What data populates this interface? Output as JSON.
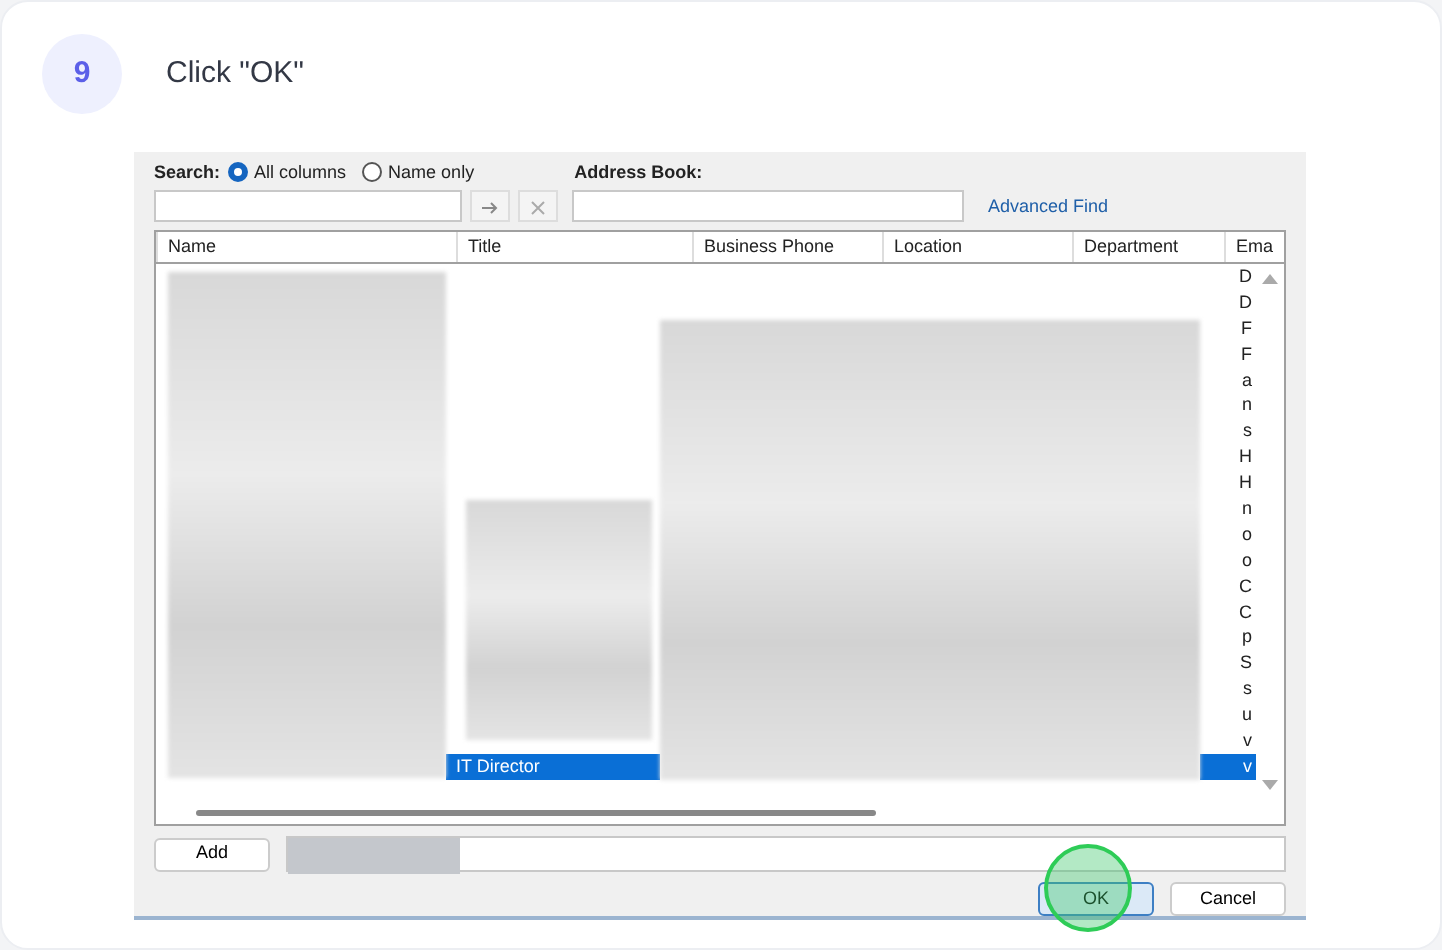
{
  "step": {
    "number": "9",
    "instruction": "Click \"OK\""
  },
  "dialog": {
    "search_label": "Search:",
    "search_options": [
      {
        "label": "All columns",
        "selected": true
      },
      {
        "label": "Name only",
        "selected": false
      }
    ],
    "address_book_label": "Address Book:",
    "advanced_find": "Advanced Find",
    "columns": [
      "Name",
      "Title",
      "Business Phone",
      "Location",
      "Department",
      "Ema"
    ],
    "rows": [
      {
        "email": "D",
        "selected": false
      },
      {
        "email": "D",
        "selected": false
      },
      {
        "email": "F",
        "selected": false
      },
      {
        "email": "F",
        "selected": false
      },
      {
        "email": "a",
        "selected": false
      },
      {
        "email": "n",
        "selected": false
      },
      {
        "email": "s",
        "selected": false
      },
      {
        "email": "H",
        "selected": false
      },
      {
        "email": "H",
        "selected": false
      },
      {
        "email": "n",
        "selected": false
      },
      {
        "email": "o",
        "selected": false
      },
      {
        "email": "o",
        "selected": false
      },
      {
        "email": "C",
        "selected": false
      },
      {
        "email": "C",
        "selected": false
      },
      {
        "email": "p",
        "selected": false
      },
      {
        "email": "S",
        "selected": false
      },
      {
        "email": "s",
        "selected": false
      },
      {
        "email": "u",
        "selected": false
      },
      {
        "email": "v",
        "selected": false
      },
      {
        "title": "IT Director",
        "email": "v",
        "selected": true
      }
    ],
    "add_button": "Add",
    "ok_button": "OK",
    "cancel_button": "Cancel"
  }
}
